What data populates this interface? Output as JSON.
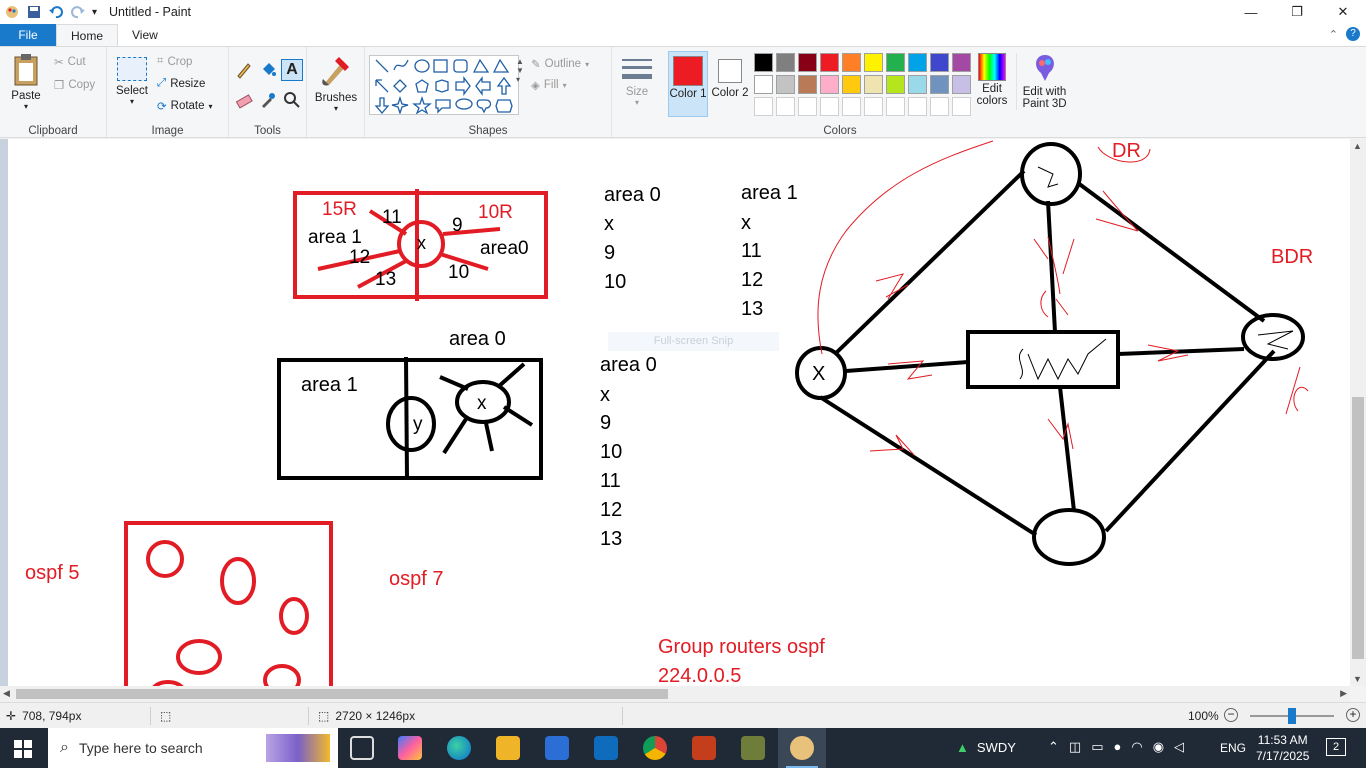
{
  "window": {
    "title": "Untitled - Paint",
    "minimize": "—",
    "restore": "❐",
    "close": "✕"
  },
  "tabs": [
    "File",
    "Home",
    "View"
  ],
  "ribbon": {
    "clipboard": {
      "label": "Clipboard",
      "paste": "Paste",
      "cut": "Cut",
      "copy": "Copy"
    },
    "image": {
      "label": "Image",
      "select": "Select",
      "crop": "Crop",
      "resize": "Resize",
      "rotate": "Rotate"
    },
    "tools": {
      "label": "Tools"
    },
    "brushes": {
      "label": "Brushes"
    },
    "shapes": {
      "label": "Shapes",
      "outline": "Outline",
      "fill": "Fill"
    },
    "size": {
      "label": "Size"
    },
    "colors": {
      "label": "Colors",
      "color1": "Color 1",
      "color2": "Color 2",
      "edit_colors": "Edit colors",
      "edit_3d": "Edit with Paint 3D",
      "color1_value": "#ed1c24",
      "color2_value": "#ffffff",
      "palette_row1": [
        "#000000",
        "#7f7f7f",
        "#880015",
        "#ed1c24",
        "#ff7f27",
        "#fff200",
        "#22b14c",
        "#00a2e8",
        "#3f48cc",
        "#a349a4"
      ],
      "palette_row2": [
        "#ffffff",
        "#c3c3c3",
        "#b97a57",
        "#ffaec9",
        "#ffc90e",
        "#efe4b0",
        "#b5e61d",
        "#99d9ea",
        "#7092be",
        "#c8bfe7"
      ]
    }
  },
  "canvas": {
    "box1": {
      "left_label": "15R",
      "right_label": "10R",
      "area1": "area 1",
      "area0": "area0",
      "x": "x",
      "n9": "9",
      "n10": "10",
      "n11": "11",
      "n12": "12",
      "n13": "13"
    },
    "list_a": {
      "title": "area 0",
      "items": [
        "x",
        "9",
        "10"
      ]
    },
    "list_b": {
      "title": "area 1",
      "items": [
        "x",
        "11",
        "12",
        "13"
      ]
    },
    "box2": {
      "top_label": "area 0",
      "area1": "area 1",
      "y": "y",
      "x": "x"
    },
    "list_c": {
      "title": "area 0",
      "items": [
        "x",
        "9",
        "10",
        "11",
        "12",
        "13"
      ]
    },
    "snip_ghost": "Full-screen Snip",
    "ospf5": "ospf 5",
    "ospf7": "ospf 7",
    "group_line1": "Group routers ospf",
    "group_line2": "224.0.0.5",
    "topology": {
      "dr": "DR",
      "bdr": "BDR",
      "x": "X"
    }
  },
  "status": {
    "cursor": "708, 794px",
    "size": "2720 × 1246px",
    "zoom": "100%",
    "zoom_level": 0.5
  },
  "taskbar": {
    "search_placeholder": "Type here to search",
    "tray_label": "SWDY",
    "lang": "ENG",
    "time": "11:53 AM",
    "date": "7/17/2025",
    "notif_count": "2"
  }
}
